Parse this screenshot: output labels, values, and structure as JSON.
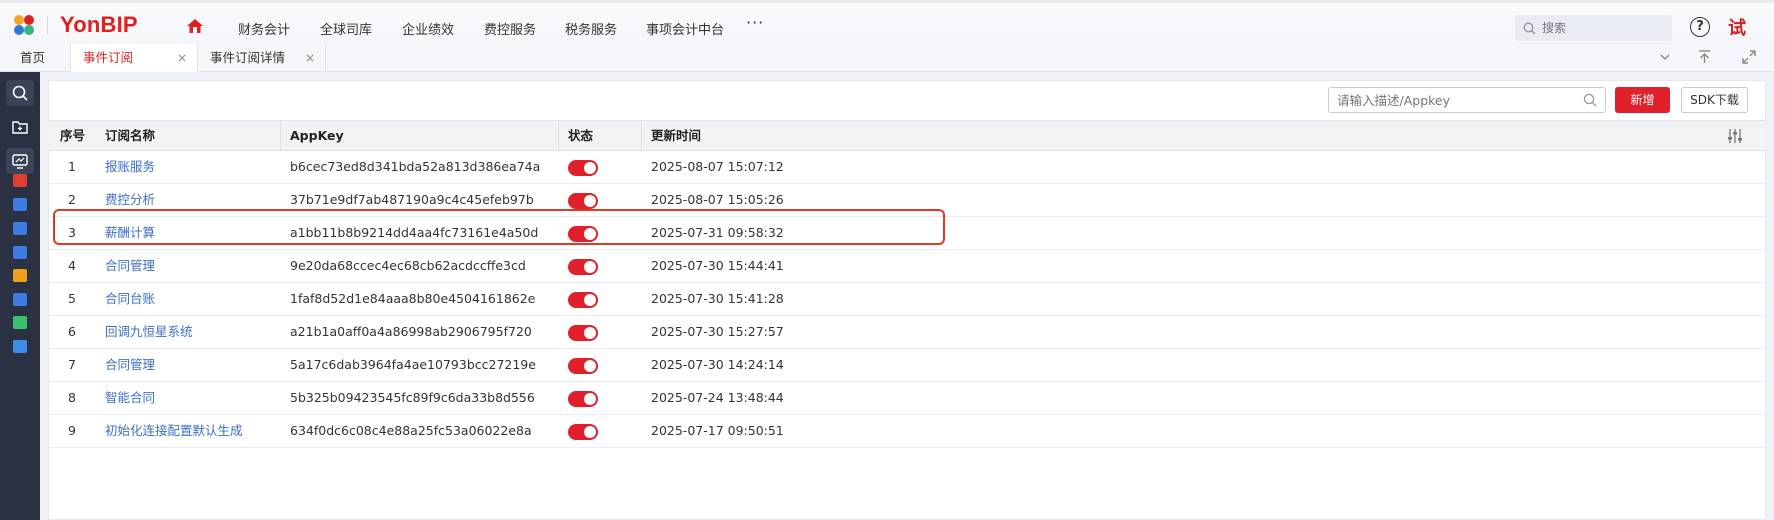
{
  "header": {
    "logo_text": "YonBIP",
    "nav": [
      "财务会计",
      "全球司库",
      "企业绩效",
      "费控服务",
      "税务服务",
      "事项会计中台"
    ],
    "more": "···",
    "search_placeholder": "搜索",
    "help": "?",
    "user_avatar": "试"
  },
  "tabs": {
    "home": "首页",
    "subscription": "事件订阅",
    "subscription_close": "×",
    "detail": "事件订阅详情",
    "detail_close": "×"
  },
  "toolbar": {
    "search_placeholder": "请输入描述/Appkey",
    "add_label": "新增",
    "sdk_label": "SDK下载"
  },
  "table": {
    "columns": [
      "序号",
      "订阅名称",
      "AppKey",
      "状态",
      "更新时间"
    ],
    "rows": [
      {
        "idx": "1",
        "name": "报账服务",
        "appkey": "b6cec73ed8d341bda52a813d386ea74a",
        "enabled": true,
        "updated": "2025-08-07 15:07:12"
      },
      {
        "idx": "2",
        "name": "费控分析",
        "appkey": "37b71e9df7ab487190a9c4c45efeb97b",
        "enabled": true,
        "updated": "2025-08-07 15:05:26"
      },
      {
        "idx": "3",
        "name": "薪酬计算",
        "appkey": "a1bb11b8b9214dd4aa4fc73161e4a50d",
        "enabled": true,
        "updated": "2025-07-31 09:58:32"
      },
      {
        "idx": "4",
        "name": "合同管理",
        "appkey": "9e20da68ccec4ec68cb62acdccffe3cd",
        "enabled": true,
        "updated": "2025-07-30 15:44:41"
      },
      {
        "idx": "5",
        "name": "合同台账",
        "appkey": "1faf8d52d1e84aaa8b80e4504161862e",
        "enabled": true,
        "updated": "2025-07-30 15:41:28"
      },
      {
        "idx": "6",
        "name": "回调九恒星系统",
        "appkey": "a21b1a0aff0a4a86998ab2906795f720",
        "enabled": true,
        "updated": "2025-07-30 15:27:57"
      },
      {
        "idx": "7",
        "name": "合同管理",
        "appkey": "5a17c6dab3964fa4ae10793bcc27219e",
        "enabled": true,
        "updated": "2025-07-30 14:24:14"
      },
      {
        "idx": "8",
        "name": "智能合同",
        "appkey": "5b325b09423545fc89f9c6da33b8d556",
        "enabled": true,
        "updated": "2025-07-24 13:48:44"
      },
      {
        "idx": "9",
        "name": "初始化连接配置默认生成",
        "appkey": "634f0dc6c08c4e88a25fc53a06022e8a",
        "enabled": true,
        "updated": "2025-07-17 09:50:51"
      }
    ]
  },
  "colors": {
    "brand_red": "#e0202a",
    "link_blue": "#3a6fc7",
    "rail_bg": "#293142",
    "highlight": "#e03a26"
  },
  "highlighted_row": "3"
}
